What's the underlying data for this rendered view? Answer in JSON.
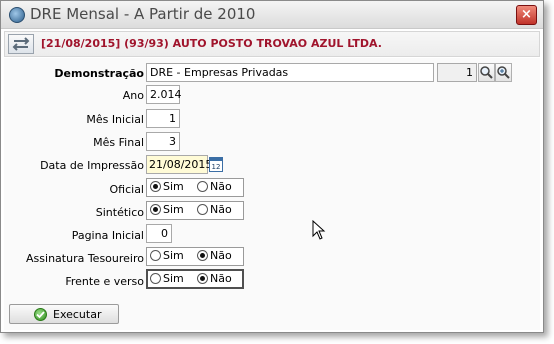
{
  "window": {
    "title": "DRE Mensal - A Partir de 2010",
    "close_label": "×"
  },
  "header": {
    "text": "[21/08/2015] (93/93) AUTO POSTO TROVAO AZUL LTDA."
  },
  "form": {
    "demonstracao": {
      "label": "Demonstração",
      "value": "DRE - Empresas Privadas",
      "code": "1"
    },
    "ano": {
      "label": "Ano",
      "value": "2.014"
    },
    "mes_inicial": {
      "label": "Mês Inicial",
      "value": "1"
    },
    "mes_final": {
      "label": "Mês Final",
      "value": "3"
    },
    "data_impressao": {
      "label": "Data de Impressão",
      "value": "21/08/2015"
    },
    "oficial": {
      "label": "Oficial",
      "options": [
        "Sim",
        "Não"
      ],
      "selected": "Sim"
    },
    "sintetico": {
      "label": "Sintético",
      "options": [
        "Sim",
        "Não"
      ],
      "selected": "Sim"
    },
    "pagina_inicial": {
      "label": "Pagina Inicial",
      "value": "0"
    },
    "assinatura": {
      "label": "Assinatura Tesoureiro",
      "options": [
        "Sim",
        "Não"
      ],
      "selected": "Não"
    },
    "frente_verso": {
      "label": "Frente e verso",
      "options": [
        "Sim",
        "Não"
      ],
      "selected": "Não"
    }
  },
  "footer": {
    "execute_label": "Executar"
  },
  "colors": {
    "header_text": "#a0142c",
    "close_button": "#c0332a",
    "calendar_field": "#fffbd6"
  },
  "icons": [
    "app-icon",
    "swap-arrows-icon",
    "close-icon",
    "search-icon",
    "search-plus-icon",
    "calendar-icon",
    "check-icon",
    "mouse-cursor-icon"
  ]
}
